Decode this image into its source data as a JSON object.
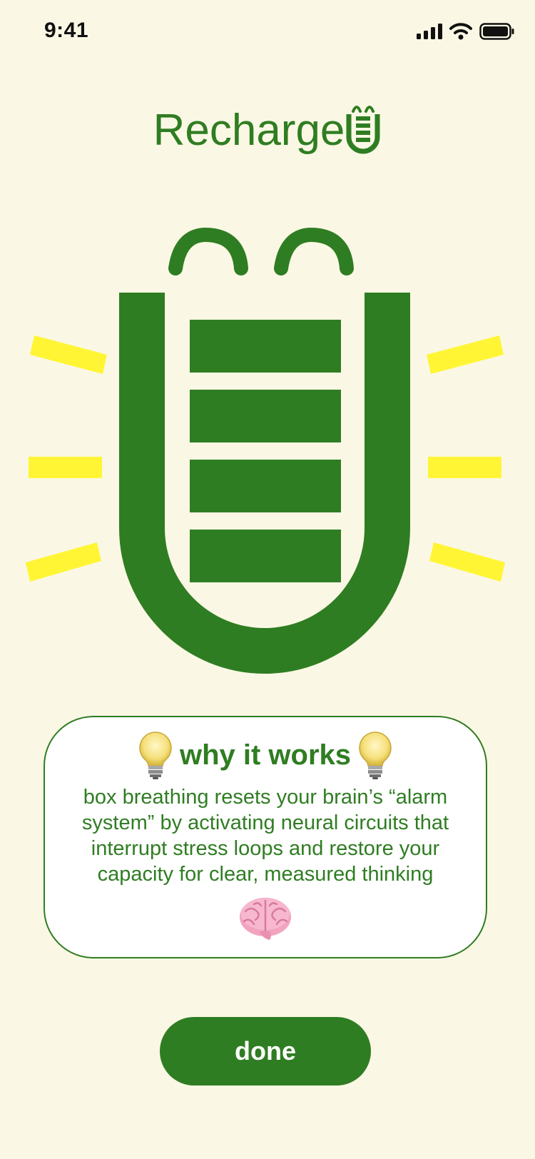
{
  "status_bar": {
    "time": "9:41"
  },
  "app": {
    "title": "Recharge",
    "logo_icon": "battery-mascot-icon"
  },
  "mascot": {
    "icon": "battery-mascot-icon",
    "ray_icon": "glow-ray-icon"
  },
  "card": {
    "heading": "why it works",
    "heading_icons": [
      "lightbulb-icon",
      "lightbulb-icon"
    ],
    "body": "box breathing resets your brain’s “alarm system” by activating neural circuits that interrupt stress loops and restore your capacity for clear, measured thinking",
    "footer_icon": "brain-icon"
  },
  "actions": {
    "done_label": "done"
  },
  "colors": {
    "background": "#FAF8E4",
    "primary_green": "#2F7D22",
    "glow_yellow": "#FFF535",
    "card_background": "#FFFFFF"
  }
}
